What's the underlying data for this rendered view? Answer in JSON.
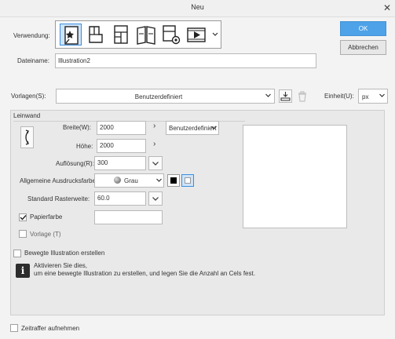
{
  "window": {
    "title": "Neu"
  },
  "usage": {
    "label": "Verwendung:"
  },
  "filename": {
    "label": "Dateiname:",
    "value": "Illustration2"
  },
  "buttons": {
    "ok": "OK",
    "cancel": "Abbrechen"
  },
  "template": {
    "label": "Vorlagen(S):",
    "value": "Benutzerdefiniert"
  },
  "unit": {
    "label": "Einheit(U):",
    "value": "px"
  },
  "canvas": {
    "section_label": "Leinwand",
    "width_label": "Breite(W):",
    "width_value": "2000",
    "height_label": "Höhe:",
    "height_value": "2000",
    "preset_value": "Benutzerdefiniert",
    "resolution_label": "Auflösung(R):",
    "resolution_value": "300",
    "color_label": "Allgemeine Ausdrucksfarbe:",
    "color_value": "Grau",
    "screen_label": "Standard Rasterweite:",
    "screen_value": "60.0",
    "paper_label": "Papierfarbe",
    "template_label": "Vorlage (T)"
  },
  "animation": {
    "label": "Bewegte Illustration erstellen",
    "info_line1": "Aktivieren Sie dies,",
    "info_line2": "um eine bewegte Illustration zu erstellen, und legen Sie die Anzahl an Cels fest."
  },
  "timelapse": {
    "label": "Zeitraffer aufnehmen"
  },
  "colors": {
    "accent": "#4da2e8",
    "paper": "#ffffff"
  }
}
